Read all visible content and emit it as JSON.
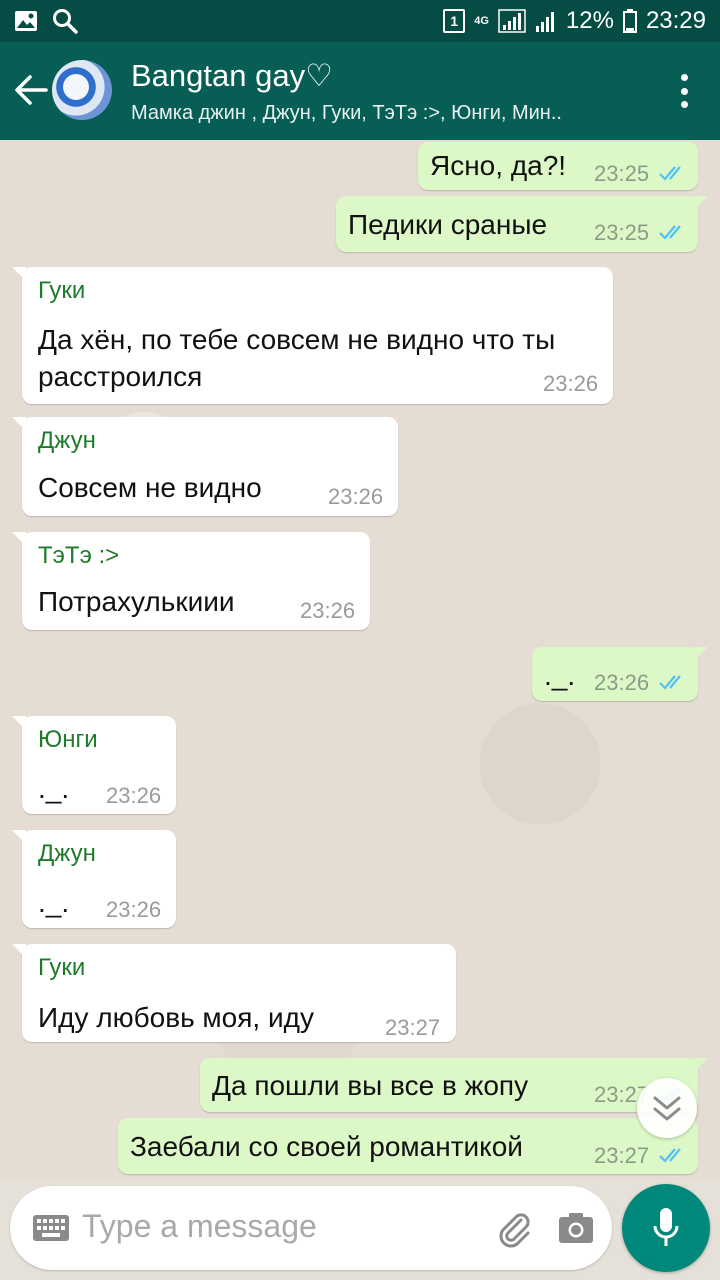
{
  "status_bar": {
    "sim_slot": "1",
    "network": "4G",
    "battery": "12%",
    "time": "23:29"
  },
  "header": {
    "title": "Bangtan gay♡",
    "subtitle": "Мамка джин , Джун, Гуки, ТэТэ :>, Юнги, Мин..",
    "back_icon": "arrow-left-icon",
    "menu_icon": "more-vert-icon"
  },
  "messages": [
    {
      "dir": "out",
      "text": "Ясно, да?!",
      "time": "23:25",
      "status": "read"
    },
    {
      "dir": "out",
      "text": "Педики сраные",
      "time": "23:25",
      "status": "read"
    },
    {
      "dir": "in",
      "sender": "Гуки",
      "text": "Да хён, по тебе совсем не видно что ты расстроился",
      "time": "23:26"
    },
    {
      "dir": "in",
      "sender": "Джун",
      "text": "Совсем не видно",
      "time": "23:26"
    },
    {
      "dir": "in",
      "sender": "ТэТэ :>",
      "text": "Потрахулькиии",
      "time": "23:26"
    },
    {
      "dir": "out",
      "text": "._.",
      "time": "23:26",
      "status": "read"
    },
    {
      "dir": "in",
      "sender": "Юнги",
      "text": "._.",
      "time": "23:26"
    },
    {
      "dir": "in",
      "sender": "Джун",
      "text": "._.",
      "time": "23:26"
    },
    {
      "dir": "in",
      "sender": "Гуки",
      "text": "Иду любовь моя, иду",
      "time": "23:27"
    },
    {
      "dir": "out",
      "text": "Да пошли вы все в жопу",
      "time": "23:27",
      "status": "read"
    },
    {
      "dir": "out",
      "text": "Заебали со своей романтикой",
      "time": "23:27",
      "status": "read"
    }
  ],
  "composer": {
    "placeholder": "Type a message",
    "keyboard_icon": "keyboard-icon",
    "attach_icon": "paperclip-icon",
    "camera_icon": "camera-icon",
    "mic_icon": "mic-icon"
  },
  "colors": {
    "status_bar": "#054d44",
    "app_bar": "#075e54",
    "outgoing_bubble": "#dcf8c6",
    "incoming_bubble": "#ffffff",
    "sender_name": "#1f7a2b",
    "read_ticks": "#4fc3f7",
    "mic_button": "#00897b"
  }
}
